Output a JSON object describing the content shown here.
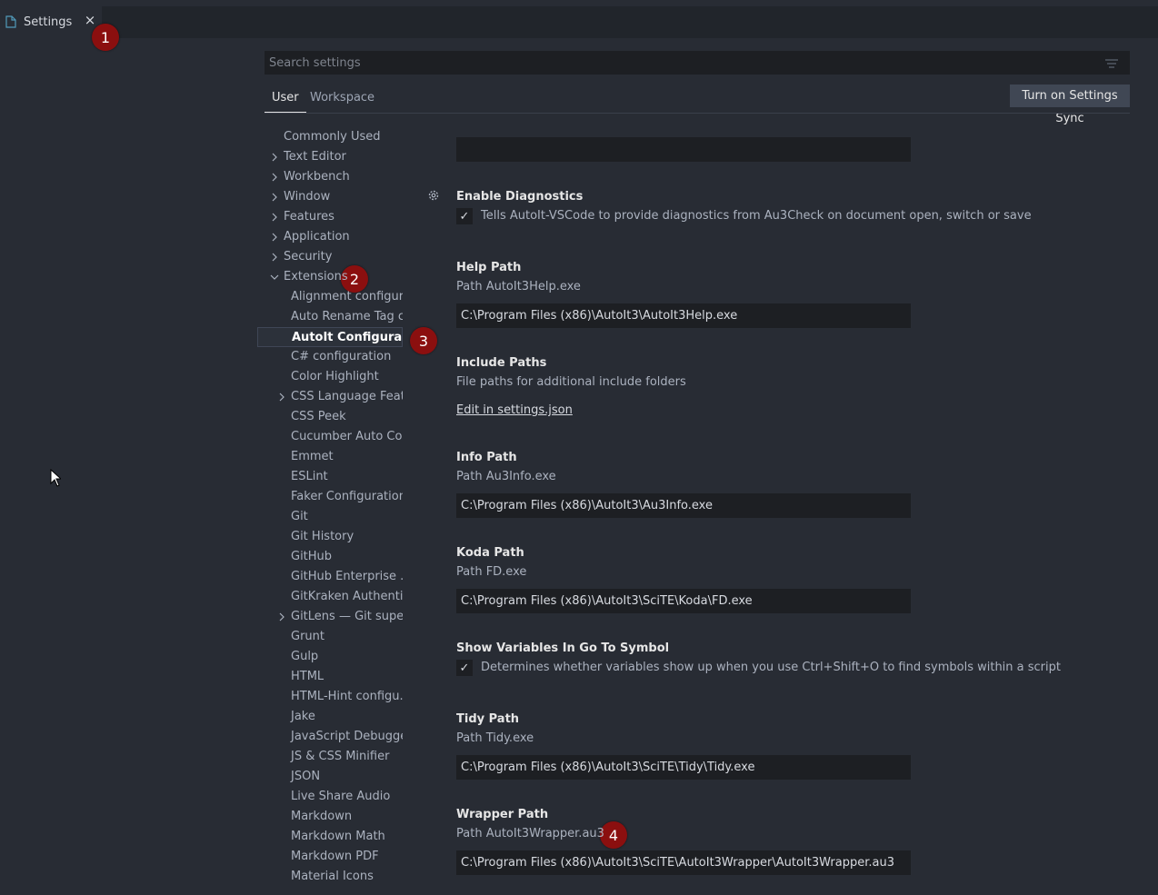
{
  "tab": {
    "label": "Settings",
    "close": "×"
  },
  "badges": [
    "1",
    "2",
    "3",
    "4"
  ],
  "search": {
    "placeholder": "Search settings"
  },
  "scope_tabs": {
    "user": "User",
    "workspace": "Workspace"
  },
  "sync_button": "Turn on Settings Sync",
  "toc": [
    {
      "label": "Commonly Used"
    },
    {
      "label": "Text Editor",
      "chevron": ">"
    },
    {
      "label": "Workbench",
      "chevron": ">"
    },
    {
      "label": "Window",
      "chevron": ">"
    },
    {
      "label": "Features",
      "chevron": ">"
    },
    {
      "label": "Application",
      "chevron": ">"
    },
    {
      "label": "Security",
      "chevron": ">"
    },
    {
      "label": "Extensions",
      "chevron": "v"
    },
    {
      "label": "Alignment configur..."
    },
    {
      "label": "Auto Rename Tag c..."
    },
    {
      "label": "AutoIt Configurat...",
      "selected": true
    },
    {
      "label": "C# configuration"
    },
    {
      "label": "Color Highlight"
    },
    {
      "label": "CSS Language Feat...",
      "chevron": ">"
    },
    {
      "label": "CSS Peek"
    },
    {
      "label": "Cucumber Auto Co..."
    },
    {
      "label": "Emmet"
    },
    {
      "label": "ESLint"
    },
    {
      "label": "Faker Configuration"
    },
    {
      "label": "Git"
    },
    {
      "label": "Git History"
    },
    {
      "label": "GitHub"
    },
    {
      "label": "GitHub Enterprise ..."
    },
    {
      "label": "GitKraken Authenti..."
    },
    {
      "label": "GitLens — Git supe...",
      "chevron": ">"
    },
    {
      "label": "Grunt"
    },
    {
      "label": "Gulp"
    },
    {
      "label": "HTML"
    },
    {
      "label": "HTML-Hint configu..."
    },
    {
      "label": "Jake"
    },
    {
      "label": "JavaScript Debugger"
    },
    {
      "label": "JS & CSS Minifier"
    },
    {
      "label": "JSON"
    },
    {
      "label": "Live Share Audio"
    },
    {
      "label": "Markdown"
    },
    {
      "label": "Markdown Math"
    },
    {
      "label": "Markdown PDF"
    },
    {
      "label": "Material Icons"
    }
  ],
  "settings": {
    "diagnostics": {
      "title": "Enable Diagnostics",
      "checked": "✓",
      "desc": "Tells AutoIt-VSCode to provide diagnostics from Au3Check on document open, switch or save"
    },
    "help_path": {
      "title": "Help Path",
      "desc": "Path AutoIt3Help.exe",
      "value": "C:\\Program Files (x86)\\AutoIt3\\AutoIt3Help.exe"
    },
    "include_paths": {
      "title": "Include Paths",
      "desc": "File paths for additional include folders",
      "link": "Edit in settings.json"
    },
    "info_path": {
      "title": "Info Path",
      "desc": "Path Au3Info.exe",
      "value": "C:\\Program Files (x86)\\AutoIt3\\Au3Info.exe"
    },
    "koda_path": {
      "title": "Koda Path",
      "desc": "Path FD.exe",
      "value": "C:\\Program Files (x86)\\AutoIt3\\SciTE\\Koda\\FD.exe"
    },
    "show_variables": {
      "title": "Show Variables In Go To Symbol",
      "checked": "✓",
      "desc": "Determines whether variables show up when you use Ctrl+Shift+O to find symbols within a script"
    },
    "tidy_path": {
      "title": "Tidy Path",
      "desc": "Path Tidy.exe",
      "value": "C:\\Program Files (x86)\\AutoIt3\\SciTE\\Tidy\\Tidy.exe"
    },
    "wrapper_path": {
      "title": "Wrapper Path",
      "desc": "Path AutoIt3Wrapper.au3",
      "value": "C:\\Program Files (x86)\\AutoIt3\\SciTE\\AutoIt3Wrapper\\AutoIt3Wrapper.au3"
    }
  },
  "colors": {
    "background": "#282c34",
    "badge": "#8b0f0f",
    "input_bg": "#1d1f23"
  }
}
